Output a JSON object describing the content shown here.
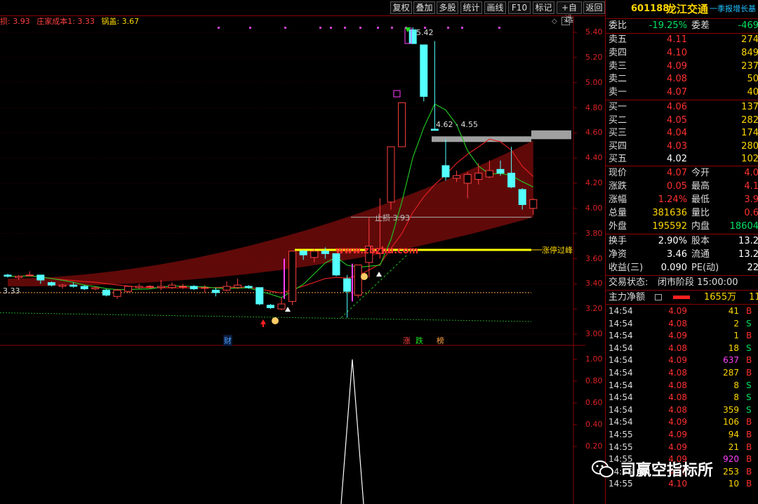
{
  "toolbar": {
    "buttons": [
      "复权",
      "叠加",
      "多股",
      "统计",
      "画线",
      "F10",
      "标记",
      "+自选",
      "返回"
    ]
  },
  "legend": {
    "stoploss": "损: 3.93",
    "cost": "庄家成本1: 3.33",
    "cover": "锅盖: 3.67"
  },
  "chart": {
    "y_labels": [
      "5.40",
      "5.20",
      "5.00",
      "4.80",
      "4.60",
      "4.40",
      "4.20",
      "4.00",
      "3.80",
      "3.60",
      "3.40",
      "3.20",
      "3.00"
    ],
    "lower_y_labels": [
      "1.00",
      "0.80",
      "0.60",
      "0.40",
      "0.20"
    ],
    "annotations": {
      "high": "5.42",
      "range": "4.62 - 4.55",
      "stop": "止损 3.93",
      "limit": "涨停过峰",
      "cost_line": "3.33",
      "url": "www.zbzhu.com"
    },
    "markers": {
      "cai": "财",
      "zhang": "涨",
      "die": "跌",
      "bang": "榜"
    }
  },
  "chart_data": {
    "type": "candlestick",
    "ylim": [
      3.0,
      5.5
    ],
    "candles": [
      {
        "o": 3.47,
        "c": 3.46,
        "h": 3.48,
        "l": 3.45
      },
      {
        "o": 3.45,
        "c": 3.46,
        "h": 3.47,
        "l": 3.43
      },
      {
        "o": 3.47,
        "c": 3.47,
        "h": 3.5,
        "l": 3.46
      },
      {
        "o": 3.47,
        "c": 3.43,
        "h": 3.47,
        "l": 3.4
      },
      {
        "o": 3.41,
        "c": 3.39,
        "h": 3.42,
        "l": 3.38
      },
      {
        "o": 3.38,
        "c": 3.39,
        "h": 3.4,
        "l": 3.36
      },
      {
        "o": 3.39,
        "c": 3.38,
        "h": 3.41,
        "l": 3.37
      },
      {
        "o": 3.38,
        "c": 3.36,
        "h": 3.39,
        "l": 3.35
      },
      {
        "o": 3.36,
        "c": 3.37,
        "h": 3.38,
        "l": 3.35
      },
      {
        "o": 3.35,
        "c": 3.31,
        "h": 3.36,
        "l": 3.3
      },
      {
        "o": 3.3,
        "c": 3.35,
        "h": 3.36,
        "l": 3.28
      },
      {
        "o": 3.34,
        "c": 3.38,
        "h": 3.38,
        "l": 3.33
      },
      {
        "o": 3.37,
        "c": 3.38,
        "h": 3.4,
        "l": 3.36
      },
      {
        "o": 3.38,
        "c": 3.38,
        "h": 3.39,
        "l": 3.36
      },
      {
        "o": 3.37,
        "c": 3.38,
        "h": 3.43,
        "l": 3.35
      },
      {
        "o": 3.37,
        "c": 3.39,
        "h": 3.41,
        "l": 3.36
      },
      {
        "o": 3.38,
        "c": 3.38,
        "h": 3.4,
        "l": 3.36
      },
      {
        "o": 3.38,
        "c": 3.36,
        "h": 3.39,
        "l": 3.35
      },
      {
        "o": 3.37,
        "c": 3.37,
        "h": 3.39,
        "l": 3.33
      },
      {
        "o": 3.35,
        "c": 3.33,
        "h": 3.37,
        "l": 3.3
      },
      {
        "o": 3.35,
        "c": 3.38,
        "h": 3.42,
        "l": 3.34
      },
      {
        "o": 3.37,
        "c": 3.39,
        "h": 3.44,
        "l": 3.36
      },
      {
        "o": 3.38,
        "c": 3.37,
        "h": 3.39,
        "l": 3.36
      },
      {
        "o": 3.37,
        "c": 3.24,
        "h": 3.37,
        "l": 3.23
      },
      {
        "o": 3.23,
        "c": 3.21,
        "h": 3.24,
        "l": 3.2
      },
      {
        "o": 3.2,
        "c": 3.24,
        "h": 3.29,
        "l": 3.19
      },
      {
        "o": 3.26,
        "c": 3.66,
        "h": 3.66,
        "l": 3.23
      },
      {
        "o": 3.66,
        "c": 3.63,
        "h": 3.67,
        "l": 3.59
      },
      {
        "o": 3.61,
        "c": 3.66,
        "h": 3.68,
        "l": 3.57
      },
      {
        "o": 3.66,
        "c": 3.64,
        "h": 3.69,
        "l": 3.6
      },
      {
        "o": 3.64,
        "c": 3.47,
        "h": 3.64,
        "l": 3.46
      },
      {
        "o": 3.44,
        "c": 3.34,
        "h": 3.47,
        "l": 3.13
      },
      {
        "o": 3.31,
        "c": 3.55,
        "h": 3.55,
        "l": 3.29
      },
      {
        "o": 3.57,
        "c": 3.7,
        "h": 3.93,
        "l": 3.45
      },
      {
        "o": 3.64,
        "c": 3.68,
        "h": 4.08,
        "l": 3.6
      },
      {
        "o": 4.05,
        "c": 4.49,
        "h": 4.49,
        "l": 3.99
      },
      {
        "o": 4.49,
        "c": 4.84,
        "h": 4.84,
        "l": 4.49
      },
      {
        "o": 5.42,
        "c": 5.31,
        "h": 5.44,
        "l": 5.31
      },
      {
        "o": 5.3,
        "c": 4.89,
        "h": 5.3,
        "l": 4.85
      },
      {
        "o": 4.63,
        "c": 4.62,
        "h": 5.33,
        "l": 4.62
      },
      {
        "o": 4.34,
        "c": 4.25,
        "h": 4.55,
        "l": 4.22
      },
      {
        "o": 4.24,
        "c": 4.26,
        "h": 4.3,
        "l": 4.21
      },
      {
        "o": 4.2,
        "c": 4.27,
        "h": 4.29,
        "l": 4.08
      },
      {
        "o": 4.23,
        "c": 4.28,
        "h": 4.36,
        "l": 4.19
      },
      {
        "o": 4.25,
        "c": 4.3,
        "h": 4.38,
        "l": 4.24
      },
      {
        "o": 4.31,
        "c": 4.28,
        "h": 4.38,
        "l": 4.26
      },
      {
        "o": 4.28,
        "c": 4.17,
        "h": 4.49,
        "l": 4.16
      },
      {
        "o": 4.15,
        "c": 4.03,
        "h": 4.16,
        "l": 3.99
      },
      {
        "o": 4.0,
        "c": 4.07,
        "h": 4.08,
        "l": 3.95
      }
    ],
    "stoploss": 3.93,
    "cost": 3.33,
    "cover": 3.67
  },
  "panel": {
    "code": "601188",
    "name": "龙江交通",
    "tag": "一季报增长基",
    "ratio_label": "委比",
    "ratio": "-19.25%",
    "diff_label": "委差",
    "diff": "-469",
    "asks": [
      {
        "label": "卖五",
        "price": "4.11",
        "vol": "274"
      },
      {
        "label": "卖四",
        "price": "4.10",
        "vol": "849"
      },
      {
        "label": "卖三",
        "price": "4.09",
        "vol": "237"
      },
      {
        "label": "卖二",
        "price": "4.08",
        "vol": "50"
      },
      {
        "label": "卖一",
        "price": "4.07",
        "vol": "40"
      }
    ],
    "bids": [
      {
        "label": "买一",
        "price": "4.06",
        "vol": "137"
      },
      {
        "label": "买二",
        "price": "4.05",
        "vol": "282"
      },
      {
        "label": "买三",
        "price": "4.04",
        "vol": "174"
      },
      {
        "label": "买四",
        "price": "4.03",
        "vol": "280"
      },
      {
        "label": "买五",
        "price": "4.02",
        "vol": "102"
      }
    ],
    "stats": [
      {
        "l1": "现价",
        "v1": "4.07",
        "l2": "今开",
        "v2": "4.0"
      },
      {
        "l1": "涨跌",
        "v1": "0.05",
        "l2": "最高",
        "v2": "4.1"
      },
      {
        "l1": "涨幅",
        "v1": "1.24%",
        "l2": "最低",
        "v2": "3.9"
      },
      {
        "l1": "总量",
        "v1": "381636",
        "l2": "量比",
        "v2": "0.6"
      },
      {
        "l1": "外盘",
        "v1": "195592",
        "l2": "内盘",
        "v2": "18604"
      }
    ],
    "stats2": [
      {
        "l1": "换手",
        "v1": "2.90%",
        "l2": "股本",
        "v2": "13.2"
      },
      {
        "l1": "净资",
        "v1": "3.46",
        "l2": "流通",
        "v2": "13.2"
      },
      {
        "l1": "收益(三)",
        "v1": "0.090",
        "l2": "PE(动)",
        "v2": "22"
      }
    ],
    "status_label": "交易状态:",
    "status": "闭市阶段 15:00:00",
    "main_label": "主力净额",
    "main_value": "1655万",
    "main_value2": "11",
    "ticks": [
      {
        "t": "14:54",
        "p": "4.09",
        "v": "41",
        "bs": "B"
      },
      {
        "t": "14:54",
        "p": "4.08",
        "v": "2",
        "bs": "S"
      },
      {
        "t": "14:54",
        "p": "4.09",
        "v": "1",
        "bs": "B"
      },
      {
        "t": "14:54",
        "p": "4.08",
        "v": "18",
        "bs": "S"
      },
      {
        "t": "14:54",
        "p": "4.09",
        "v": "637",
        "bs": "B"
      },
      {
        "t": "14:54",
        "p": "4.08",
        "v": "287",
        "bs": "B"
      },
      {
        "t": "14:54",
        "p": "4.08",
        "v": "8",
        "bs": "S"
      },
      {
        "t": "14:54",
        "p": "4.08",
        "v": "8",
        "bs": "S"
      },
      {
        "t": "14:54",
        "p": "4.08",
        "v": "359",
        "bs": "S"
      },
      {
        "t": "14:54",
        "p": "4.09",
        "v": "106",
        "bs": "B"
      },
      {
        "t": "14:55",
        "p": "4.09",
        "v": "94",
        "bs": "B"
      },
      {
        "t": "14:55",
        "p": "4.09",
        "v": "21",
        "bs": "B"
      },
      {
        "t": "14:55",
        "p": "4.09",
        "v": "920",
        "bs": "B"
      },
      {
        "t": "14:55",
        "p": "4.10",
        "v": "253",
        "bs": "B"
      },
      {
        "t": "14:55",
        "p": "4.10",
        "v": "10",
        "bs": "B"
      }
    ]
  },
  "watermark": {
    "text": "司赢空指标所"
  }
}
